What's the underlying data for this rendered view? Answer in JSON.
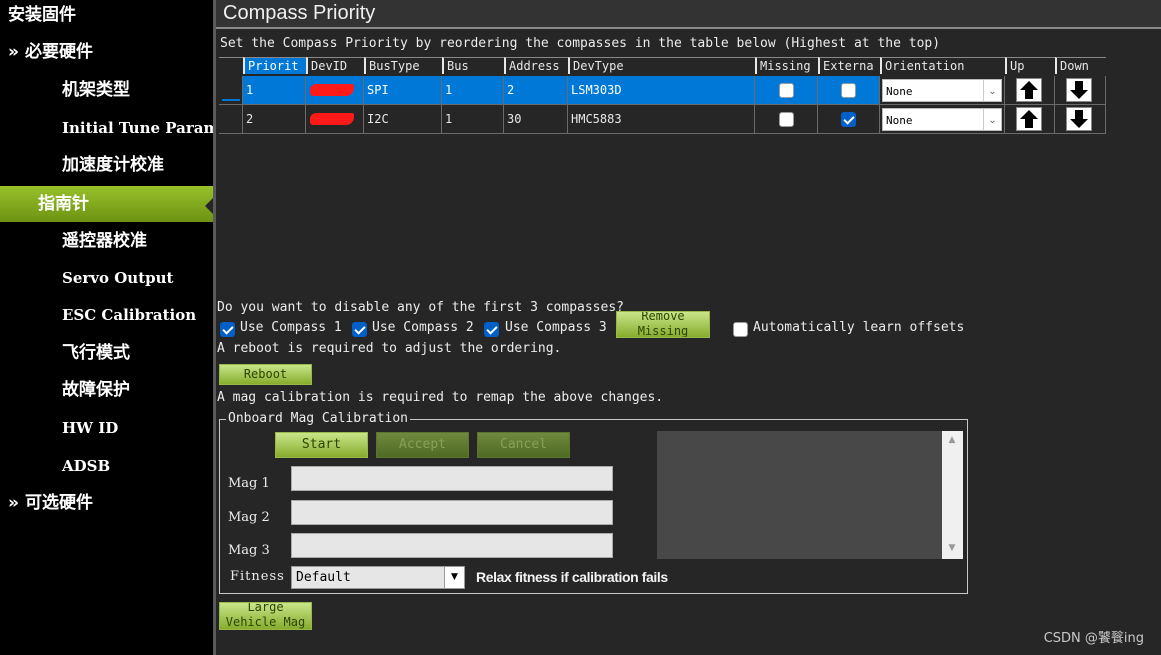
{
  "sidebar": {
    "items": [
      {
        "label": "安装固件",
        "chevron": ""
      },
      {
        "label": "必要硬件",
        "chevron": "»"
      },
      {
        "label": "机架类型",
        "chevron": ""
      },
      {
        "label": "Initial Tune Parameters",
        "chevron": ""
      },
      {
        "label": "加速度计校准",
        "chevron": ""
      },
      {
        "label": "指南针",
        "chevron": "",
        "active": true
      },
      {
        "label": "遥控器校准",
        "chevron": ""
      },
      {
        "label": "Servo Output",
        "chevron": ""
      },
      {
        "label": "ESC Calibration",
        "chevron": ""
      },
      {
        "label": "飞行模式",
        "chevron": ""
      },
      {
        "label": "故障保护",
        "chevron": ""
      },
      {
        "label": "HW ID",
        "chevron": ""
      },
      {
        "label": "ADSB",
        "chevron": ""
      },
      {
        "label": "可选硬件",
        "chevron": "»"
      }
    ]
  },
  "header": {
    "title": "Compass Priority"
  },
  "instructions": "Set the Compass Priority by reordering the compasses in the table below (Highest at the top)",
  "grid": {
    "columns": [
      "Priorit",
      "DevID",
      "BusType",
      "Bus",
      "Address",
      "DevType",
      "Missing",
      "Externa",
      "Orientation",
      "Up",
      "Down"
    ],
    "rows": [
      {
        "priority": "1",
        "bus_type": "SPI",
        "bus": "1",
        "address": "2",
        "dev_type": "LSM303D",
        "missing": false,
        "external": false,
        "orientation": "None"
      },
      {
        "priority": "2",
        "bus_type": "I2C",
        "bus": "1",
        "address": "30",
        "dev_type": "HMC5883",
        "missing": false,
        "external": true,
        "orientation": "None"
      }
    ]
  },
  "disable_question": "Do you want to disable any of the first 3 compasses?",
  "use_compass": [
    "Use Compass 1",
    "Use Compass 2",
    "Use Compass 3"
  ],
  "remove_missing": {
    "line1": "Remove",
    "line2": "Missing"
  },
  "auto_learn_label": "Automatically learn offsets",
  "reboot_note": "A reboot is required to adjust the ordering.",
  "reboot_button": "Reboot",
  "mag_cal_note": "A mag calibration is required to remap the above changes.",
  "onboard": {
    "group_label": "Onboard Mag Calibration",
    "start": "Start",
    "accept": "Accept",
    "cancel": "Cancel",
    "mags": [
      "Mag 1",
      "Mag 2",
      "Mag 3"
    ],
    "fitness_label": "Fitness",
    "fitness_value": "Default",
    "relax_label": "Relax fitness if calibration fails"
  },
  "large_vehicle": {
    "line1": "Large",
    "line2": "Vehicle Mag"
  },
  "watermark": "CSDN @饕餮ing"
}
